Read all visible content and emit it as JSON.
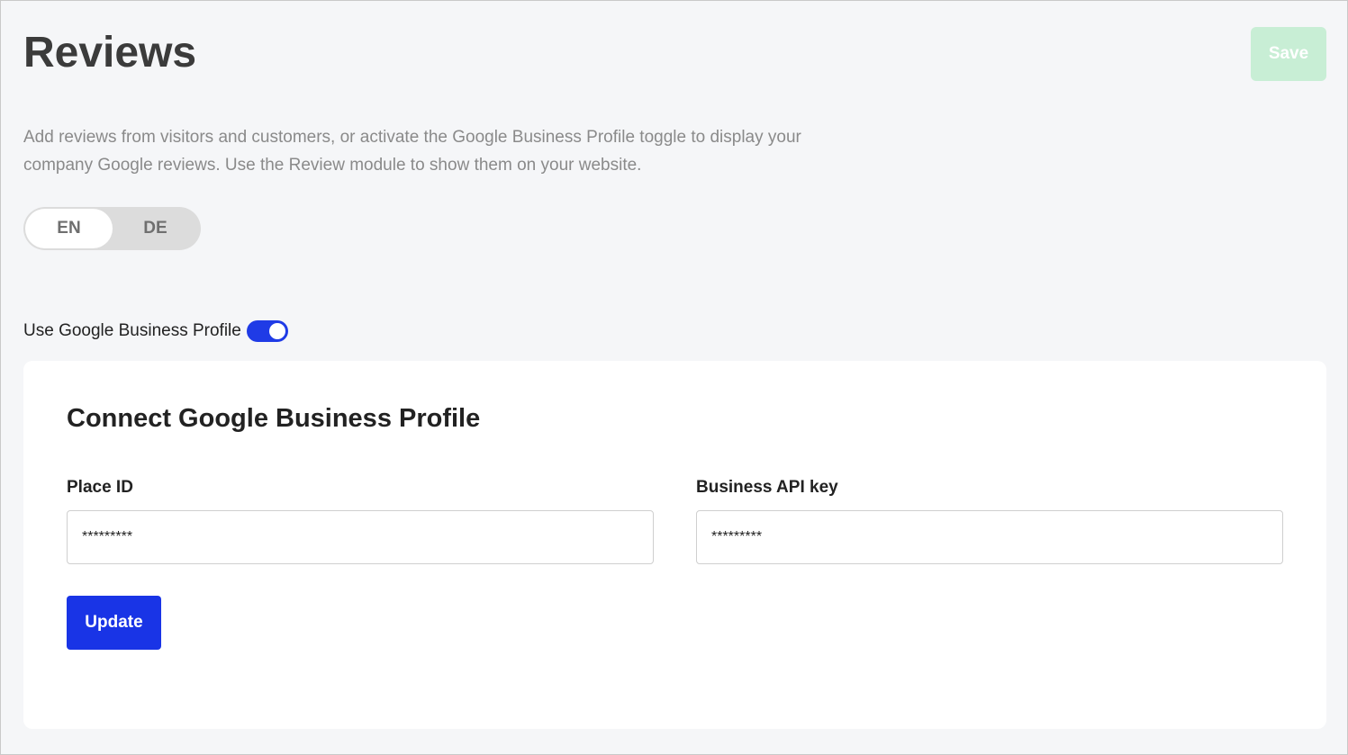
{
  "header": {
    "title": "Reviews",
    "save_label": "Save"
  },
  "description": "Add reviews from visitors and customers, or activate the Google Business Profile toggle to display your company Google reviews. Use the Review module to show them on your website.",
  "language_switch": {
    "options": [
      {
        "label": "EN",
        "active": true
      },
      {
        "label": "DE",
        "active": false
      }
    ]
  },
  "google_profile_toggle": {
    "label": "Use Google Business Profile",
    "enabled": true
  },
  "connect_card": {
    "title": "Connect Google Business Profile",
    "place_id": {
      "label": "Place ID",
      "value": "*********"
    },
    "api_key": {
      "label": "Business API key",
      "value": "*********"
    },
    "update_label": "Update"
  },
  "colors": {
    "primary": "#1934e6",
    "save_disabled": "#c8eed5",
    "background": "#f5f6f8"
  }
}
